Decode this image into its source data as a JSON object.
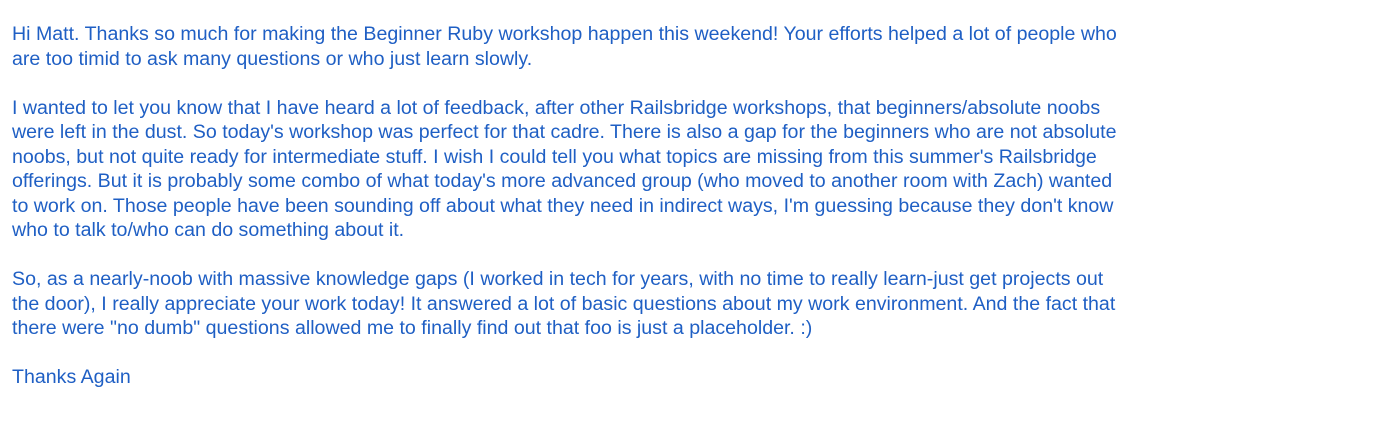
{
  "message": {
    "paragraphs": [
      {
        "lines": [
          "Hi Matt. Thanks so much for making the Beginner Ruby workshop happen this weekend! Your efforts helped a lot of people who",
          "are too timid to ask many questions or who just learn slowly."
        ]
      },
      {
        "lines": [
          "I wanted to let you know that I have heard a lot of feedback, after other Railsbridge workshops, that beginners/absolute noobs",
          "were left in the dust. So today's workshop was perfect for that cadre. There is also a gap for the beginners who are not absolute",
          "noobs, but not quite ready for intermediate stuff. I wish I could tell you what topics are missing from this summer's Railsbridge",
          "offerings. But it is probably some combo of what today's more advanced group (who moved to another room with Zach) wanted",
          "to work on. Those people have been sounding off about what they need in indirect ways, I'm guessing because they don't know",
          "who to talk to/who can do something about it."
        ]
      },
      {
        "lines": [
          "So, as a nearly-noob with massive knowledge gaps (I worked in tech for years, with no time to really learn-just get projects out",
          "the door), I really appreciate your work today! It answered a lot of basic questions about my work environment. And the fact that",
          "there were \"no dumb\" questions allowed me to finally find out that foo is just a placeholder. :)"
        ]
      }
    ],
    "signoff": "Thanks Again"
  },
  "colors": {
    "text": "#1f5fc4",
    "background": "#ffffff"
  }
}
